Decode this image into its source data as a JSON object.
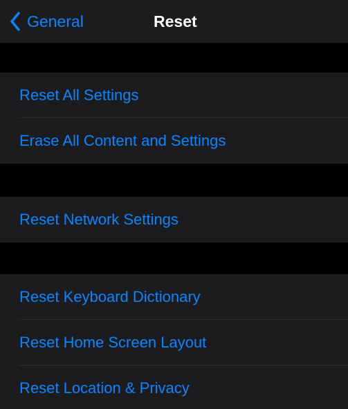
{
  "navbar": {
    "back_label": "General",
    "title": "Reset"
  },
  "groups": [
    {
      "items": [
        {
          "label": "Reset All Settings"
        },
        {
          "label": "Erase All Content and Settings"
        }
      ]
    },
    {
      "items": [
        {
          "label": "Reset Network Settings"
        }
      ]
    },
    {
      "items": [
        {
          "label": "Reset Keyboard Dictionary"
        },
        {
          "label": "Reset Home Screen Layout"
        },
        {
          "label": "Reset Location & Privacy"
        }
      ]
    }
  ],
  "colors": {
    "accent": "#0a84ff",
    "background": "#000000",
    "cell_background": "#1c1c1e",
    "separator": "#2c2c2e",
    "title": "#ffffff"
  },
  "icons": {
    "back": "chevron-left-icon"
  }
}
